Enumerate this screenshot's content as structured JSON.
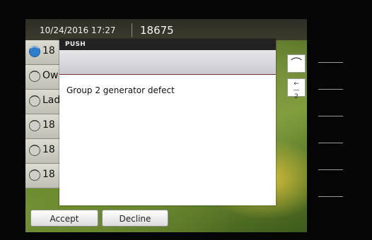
{
  "header": {
    "datetime": "10/24/2016 17:27",
    "extension": "18675"
  },
  "call_list": [
    {
      "label": "18",
      "icon": "handset-icon",
      "active": true
    },
    {
      "label": "Ow",
      "icon": "handset-icon",
      "active": false
    },
    {
      "label": "Lad",
      "icon": "handset-icon",
      "active": false
    },
    {
      "label": "18",
      "icon": "handset-icon",
      "active": false
    },
    {
      "label": "18",
      "icon": "handset-icon",
      "active": false
    },
    {
      "label": "18",
      "icon": "handset-icon",
      "active": false
    }
  ],
  "dialog": {
    "title": "PUSH",
    "message": "Group 2 generator defect"
  },
  "side_buttons": {
    "up_glyph": "⌒",
    "page_glyph": "←\n—\n2"
  },
  "actions": {
    "accept": "Accept",
    "decline": "Decline"
  },
  "colors": {
    "accent_blue": "#2f7fd0",
    "dialog_title_bg": "#222222"
  }
}
